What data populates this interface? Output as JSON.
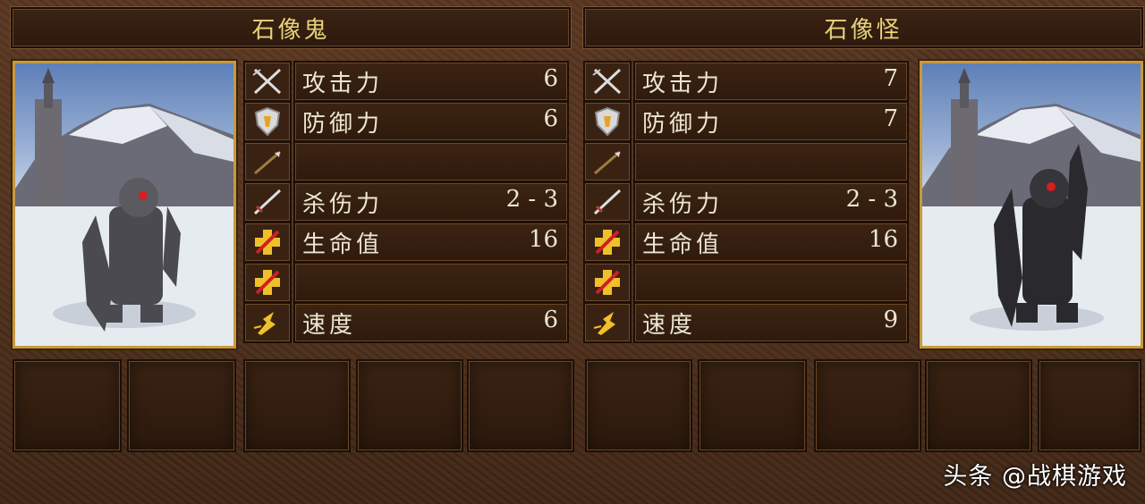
{
  "left": {
    "title": "石像鬼",
    "stats": [
      {
        "icon": "crossed-swords-icon",
        "label": "攻击力",
        "value": "6"
      },
      {
        "icon": "shield-icon",
        "label": "防御力",
        "value": "6"
      },
      {
        "icon": "arrow-icon",
        "label": "",
        "value": ""
      },
      {
        "icon": "sword-icon",
        "label": "杀伤力",
        "value": "2 - 3"
      },
      {
        "icon": "health-cross-icon",
        "label": "生命值",
        "value": "16"
      },
      {
        "icon": "health-cross-icon",
        "label": "",
        "value": ""
      },
      {
        "icon": "speed-icon",
        "label": "速度",
        "value": "6"
      }
    ]
  },
  "right": {
    "title": "石像怪",
    "stats": [
      {
        "icon": "crossed-swords-icon",
        "label": "攻击力",
        "value": "7"
      },
      {
        "icon": "shield-icon",
        "label": "防御力",
        "value": "7"
      },
      {
        "icon": "arrow-icon",
        "label": "",
        "value": ""
      },
      {
        "icon": "sword-icon",
        "label": "杀伤力",
        "value": "2 - 3"
      },
      {
        "icon": "health-cross-icon",
        "label": "生命值",
        "value": "16"
      },
      {
        "icon": "health-cross-icon",
        "label": "",
        "value": ""
      },
      {
        "icon": "speed-icon",
        "label": "速度",
        "value": "9"
      }
    ]
  },
  "watermark": "头条 @战棋游戏",
  "colors": {
    "title_text": "#e8d27a",
    "portrait_frame": "#c79a3a",
    "stat_text": "#ece6d2"
  }
}
